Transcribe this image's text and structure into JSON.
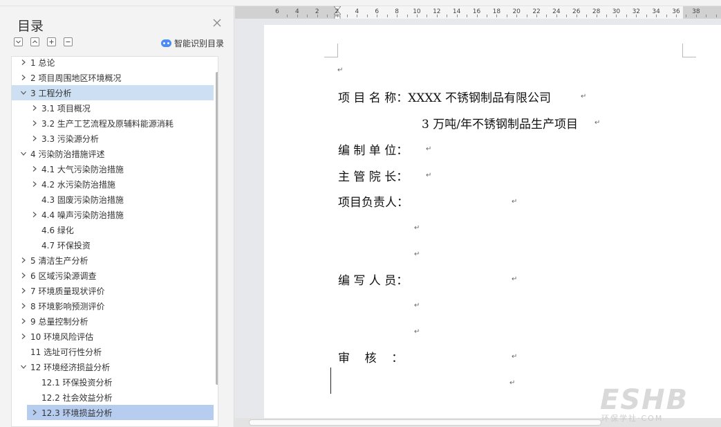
{
  "nav": {
    "title": "目录",
    "smart_label": "智能识别目录",
    "items": [
      {
        "label": "1 总论",
        "level": 1,
        "chevron": "right"
      },
      {
        "label": "2 项目周围地区环境概况",
        "level": 1,
        "chevron": "right"
      },
      {
        "label": "3 工程分析",
        "level": 1,
        "chevron": "down",
        "selected": true
      },
      {
        "label": "3.1 项目概况",
        "level": 2,
        "chevron": "right"
      },
      {
        "label": "3.2 生产工艺流程及原辅料能源消耗",
        "level": 2,
        "chevron": "right"
      },
      {
        "label": "3.3 污染源分析",
        "level": 2,
        "chevron": "right"
      },
      {
        "label": "4 污染防治措施评述",
        "level": 1,
        "chevron": "down"
      },
      {
        "label": "4.1 大气污染防治措施",
        "level": 2,
        "chevron": "right"
      },
      {
        "label": "4.2 水污染防治措施",
        "level": 2,
        "chevron": "right"
      },
      {
        "label": "4.3 固废污染防治措施",
        "level": 2,
        "chevron": "none"
      },
      {
        "label": "4.4 噪声污染防治措施",
        "level": 2,
        "chevron": "right"
      },
      {
        "label": "4.6 绿化",
        "level": 2,
        "chevron": "none"
      },
      {
        "label": "4.7 环保投资",
        "level": 2,
        "chevron": "none"
      },
      {
        "label": "5 清洁生产分析",
        "level": 1,
        "chevron": "right"
      },
      {
        "label": "6  区域污染源调查",
        "level": 1,
        "chevron": "right"
      },
      {
        "label": "7 环境质量现状评价",
        "level": 1,
        "chevron": "right"
      },
      {
        "label": "8  环境影响预测评价",
        "level": 1,
        "chevron": "right"
      },
      {
        "label": "9 总量控制分析",
        "level": 1,
        "chevron": "right"
      },
      {
        "label": "10 环境风险评估",
        "level": 1,
        "chevron": "right"
      },
      {
        "label": "11 选址可行性分析",
        "level": 1,
        "chevron": "none"
      },
      {
        "label": "12 环境经济损益分析",
        "level": 1,
        "chevron": "down"
      },
      {
        "label": "12.1 环保投资分析",
        "level": 2,
        "chevron": "none"
      },
      {
        "label": "12.2 社会效益分析",
        "level": 2,
        "chevron": "none"
      },
      {
        "label": "12.3 环境损益分析",
        "level": 2,
        "chevron": "right",
        "highlighted": true
      }
    ]
  },
  "ruler": {
    "labels": [
      "6",
      "4",
      "2",
      "2",
      "4",
      "6",
      "8",
      "10",
      "12",
      "14",
      "16",
      "18",
      "20",
      "22",
      "24",
      "26",
      "28",
      "30",
      "32",
      "34",
      "36",
      "38"
    ]
  },
  "document": {
    "lines": [
      {
        "text": "项 目 名 称：XXXX 不锈钢制品有限公司"
      },
      {
        "text": "3 万吨/年不锈钢制品生产项目"
      },
      {
        "text": "编 制 单 位："
      },
      {
        "text": "主 管 院 长："
      },
      {
        "text": "项目负责人："
      },
      {
        "text": "编 写 人 员："
      },
      {
        "text": "审    核    ："
      }
    ],
    "return_mark": "↵"
  },
  "watermark": {
    "text": "ESHB",
    "sub": "环保学社·COM"
  },
  "colors": {
    "selected_row": "#cde0f3",
    "highlighted_row": "#b6cdf0",
    "accent": "#4c8bf5"
  }
}
